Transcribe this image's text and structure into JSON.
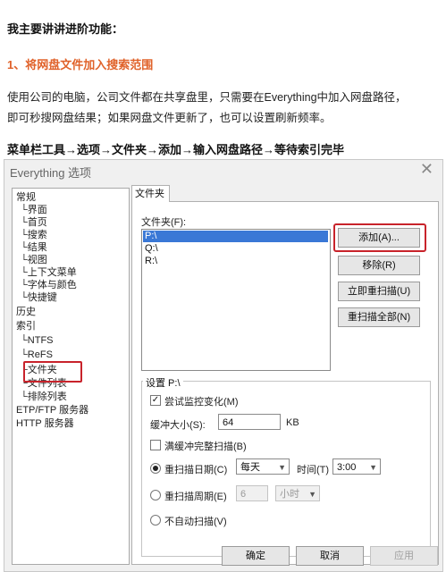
{
  "article": {
    "intro": "我主要讲讲进阶功能：",
    "section_heading": "1、将网盘文件加入搜索范围",
    "paragraph_line1": "使用公司的电脑，公司文件都在共享盘里，只需要在Everything中加入网盘路径，",
    "paragraph_line2": "即可秒搜网盘结果；如果网盘文件更新了，也可以设置刷新频率。",
    "path_heading": "菜单栏工具→选项→文件夹→添加→输入网盘路径→等待索引完毕",
    "colors": {
      "section_heading": "#e0622a",
      "highlight_box": "#c8232b"
    }
  },
  "dialog": {
    "title": "Everything 选项",
    "close_icon": "close-icon",
    "tree": [
      {
        "label": "常规",
        "level": 0
      },
      {
        "label": "界面",
        "level": 1
      },
      {
        "label": "首页",
        "level": 1
      },
      {
        "label": "搜索",
        "level": 1
      },
      {
        "label": "结果",
        "level": 1
      },
      {
        "label": "视图",
        "level": 1
      },
      {
        "label": "上下文菜单",
        "level": 1
      },
      {
        "label": "字体与颜色",
        "level": 1
      },
      {
        "label": "快捷键",
        "level": 1
      },
      {
        "label": "历史",
        "level": 0
      },
      {
        "label": "索引",
        "level": 0
      },
      {
        "label": "NTFS",
        "level": 1
      },
      {
        "label": "ReFS",
        "level": 1
      },
      {
        "label": "文件夹",
        "level": 1,
        "selected": true
      },
      {
        "label": "文件列表",
        "level": 1
      },
      {
        "label": "排除列表",
        "level": 1
      },
      {
        "label": "ETP/FTP 服务器",
        "level": 0
      },
      {
        "label": "HTTP 服务器",
        "level": 0
      }
    ],
    "tab_label": "文件夹",
    "folders_label": "文件夹(F):",
    "folders": [
      "P:\\",
      "Q:\\",
      "R:\\"
    ],
    "selected_folder_index": 0,
    "buttons": {
      "add": "添加(A)...",
      "remove": "移除(R)",
      "rescan_now": "立即重扫描(U)",
      "rescan_all": "重扫描全部(N)"
    },
    "settings": {
      "group_title": "设置 P:\\",
      "monitor_label": "尝试监控变化(M)",
      "monitor_checked": true,
      "buffer_label": "缓冲大小(S):",
      "buffer_value": "64",
      "buffer_unit": "KB",
      "full_rescan_label": "满缓冲完整扫描(B)",
      "full_rescan_checked": false,
      "daily_label": "重扫描日期(C)",
      "daily_value": "每天",
      "time_label": "时间(T)",
      "time_value": "3:00",
      "interval_label": "重扫描周期(E)",
      "interval_value": "6",
      "interval_unit": "小时",
      "never_label": "不自动扫描(V)",
      "selected_mode": "daily"
    },
    "footer": {
      "ok": "确定",
      "cancel": "取消",
      "apply": "应用"
    }
  }
}
